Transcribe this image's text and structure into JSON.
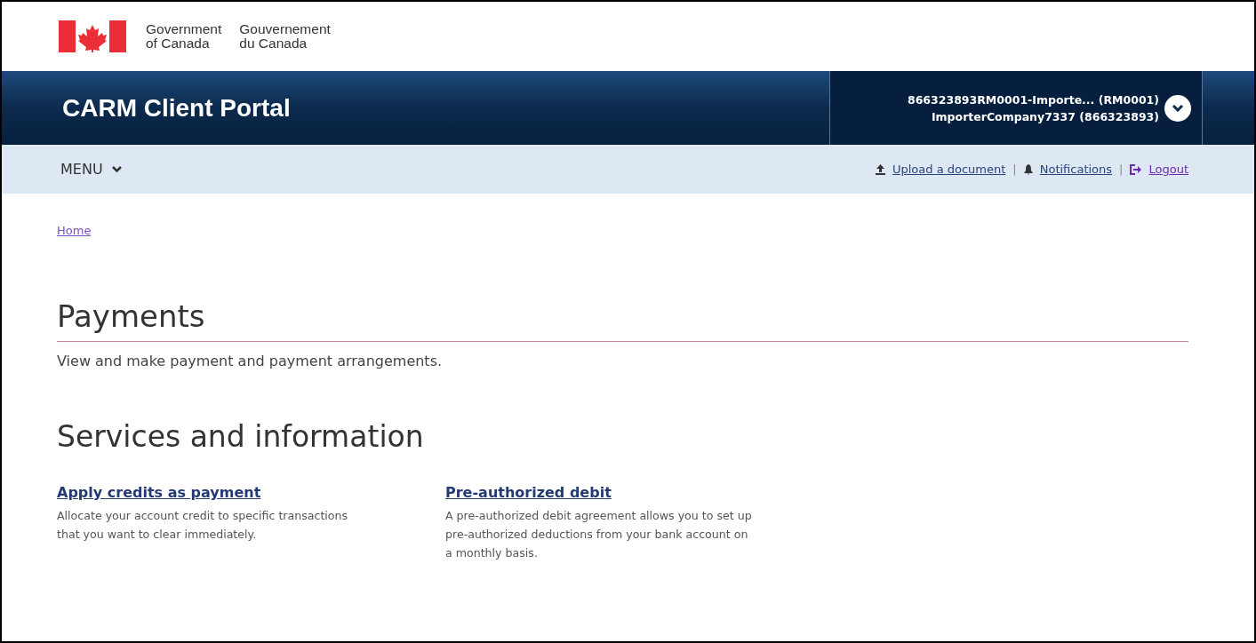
{
  "gov_header": {
    "name_en": [
      "Government",
      "of Canada"
    ],
    "name_fr": [
      "Gouvernement",
      "du Canada"
    ]
  },
  "app_bar": {
    "title": "CARM Client Portal",
    "account": {
      "line_1": "866323893RM0001-Importe... (RM0001)",
      "line_2": "ImporterCompany7337 (866323893)"
    }
  },
  "menu_bar": {
    "menu": "MENU",
    "separator": "|",
    "links": [
      {
        "kind": "upload",
        "label": "Upload a document"
      },
      {
        "kind": "bell",
        "label": "Notifications"
      },
      {
        "kind": "logout",
        "label": "Logout"
      }
    ]
  },
  "breadcrumb": [
    "Home"
  ],
  "page": {
    "title": "Payments",
    "description": "View and make payment and payment arrangements."
  },
  "services": {
    "title": "Services and information",
    "items": [
      {
        "link": "Apply credits as payment",
        "description": "Allocate your account credit to specific transactions that you want to clear immediately."
      },
      {
        "link": "Pre-authorized debit",
        "description": "A pre-authorized debit agreement allows you to set up pre-authorized deductions from your bank account on a monthly basis."
      }
    ]
  }
}
